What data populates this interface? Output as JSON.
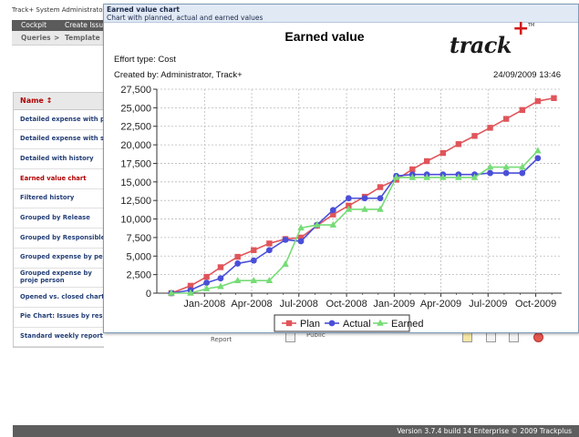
{
  "app": {
    "title": "Track+ System Administrator",
    "nav": {
      "cockpit": "Cockpit",
      "create_issue": "Create Issu"
    },
    "breadcrumb": {
      "queries": "Queries",
      "sep": ">",
      "templates": "Template"
    }
  },
  "report_list": {
    "header": "Name ↕",
    "items": [
      "Detailed expense with per",
      "Detailed expense with sub",
      "Detailed with history",
      "Earned value chart",
      "Filtered history",
      "Grouped by Release",
      "Grouped by Responsible",
      "Grouped expense by perso",
      "Grouped expense by proje person",
      "Opened vs. closed chart",
      "Pie Chart: Issues by respo",
      "Standard weekly report"
    ],
    "active_index": 3
  },
  "report_row": {
    "type_label": "Report",
    "visibility": "Public"
  },
  "footer": {
    "version": "Version 3.7.4 build 14 Enterprise  © 2009 Trackplus"
  },
  "modal": {
    "title": "Earned value chart",
    "subtitle": "Chart with planned, actual and earned values"
  },
  "report": {
    "logo": "track",
    "logo_plus": "+",
    "logo_tm": "TM",
    "effort_type": "Effort type: Cost",
    "created_by": "Created by: Administrator, Track+",
    "created_at": "24/09/2009 13:46"
  },
  "chart_data": {
    "type": "line",
    "title": "Earned value",
    "xlabel": "",
    "ylabel": "",
    "ylim": [
      0,
      27500
    ],
    "y_ticks": [
      0,
      2500,
      5000,
      7500,
      10000,
      12500,
      15000,
      17500,
      20000,
      22500,
      25000,
      27500
    ],
    "y_tick_labels": [
      "0",
      "2,500",
      "5,000",
      "7,500",
      "10,000",
      "12,500",
      "15,000",
      "17,500",
      "20,000",
      "22,500",
      "25,000",
      "27,500"
    ],
    "xlim": [
      "2007-10-01",
      "2009-11-20"
    ],
    "x_ticks": [
      "2008-01-01",
      "2008-04-01",
      "2008-07-01",
      "2008-10-01",
      "2009-01-01",
      "2009-04-01",
      "2009-07-01",
      "2009-10-01"
    ],
    "x_tick_labels": [
      "Jan-2008",
      "Apr-2008",
      "Jul-2008",
      "Oct-2008",
      "Jan-2009",
      "Apr-2009",
      "Jul-2009",
      "Oct-2009"
    ],
    "grid": true,
    "legend_position": "bottom",
    "series": [
      {
        "name": "Plan",
        "color": "#e0555a",
        "marker": "square",
        "points": [
          [
            "2007-10-29",
            0
          ],
          [
            "2007-12-05",
            1000
          ],
          [
            "2008-01-05",
            2200
          ],
          [
            "2008-02-01",
            3500
          ],
          [
            "2008-03-05",
            4900
          ],
          [
            "2008-04-05",
            5800
          ],
          [
            "2008-05-05",
            6700
          ],
          [
            "2008-06-05",
            7300
          ],
          [
            "2008-07-05",
            7500
          ],
          [
            "2008-08-05",
            9100
          ],
          [
            "2008-09-05",
            10600
          ],
          [
            "2008-10-05",
            11800
          ],
          [
            "2008-11-05",
            13000
          ],
          [
            "2008-12-05",
            14300
          ],
          [
            "2009-01-05",
            15300
          ],
          [
            "2009-02-05",
            16700
          ],
          [
            "2009-03-05",
            17800
          ],
          [
            "2009-04-05",
            18900
          ],
          [
            "2009-05-05",
            20100
          ],
          [
            "2009-06-05",
            21200
          ],
          [
            "2009-07-05",
            22300
          ],
          [
            "2009-08-05",
            23500
          ],
          [
            "2009-09-05",
            24700
          ],
          [
            "2009-10-05",
            25900
          ],
          [
            "2009-11-05",
            26300
          ]
        ]
      },
      {
        "name": "Actual",
        "color": "#4a4fd8",
        "marker": "circle",
        "points": [
          [
            "2007-10-29",
            0
          ],
          [
            "2007-12-05",
            400
          ],
          [
            "2008-01-05",
            1400
          ],
          [
            "2008-02-01",
            2000
          ],
          [
            "2008-03-05",
            4000
          ],
          [
            "2008-04-05",
            4400
          ],
          [
            "2008-05-05",
            5800
          ],
          [
            "2008-06-05",
            7200
          ],
          [
            "2008-07-05",
            7000
          ],
          [
            "2008-08-05",
            9200
          ],
          [
            "2008-09-05",
            11200
          ],
          [
            "2008-10-05",
            12800
          ],
          [
            "2008-11-05",
            12800
          ],
          [
            "2008-12-05",
            12800
          ],
          [
            "2009-01-05",
            15800
          ],
          [
            "2009-02-05",
            16000
          ],
          [
            "2009-03-05",
            16000
          ],
          [
            "2009-04-05",
            16000
          ],
          [
            "2009-05-05",
            16000
          ],
          [
            "2009-06-05",
            16000
          ],
          [
            "2009-07-05",
            16200
          ],
          [
            "2009-08-05",
            16200
          ],
          [
            "2009-09-05",
            16200
          ],
          [
            "2009-10-05",
            18200
          ]
        ]
      },
      {
        "name": "Earned",
        "color": "#76dc76",
        "marker": "triangle",
        "points": [
          [
            "2007-10-29",
            0
          ],
          [
            "2007-12-05",
            0
          ],
          [
            "2008-01-05",
            600
          ],
          [
            "2008-02-01",
            900
          ],
          [
            "2008-03-05",
            1700
          ],
          [
            "2008-04-05",
            1700
          ],
          [
            "2008-05-05",
            1700
          ],
          [
            "2008-06-05",
            3900
          ],
          [
            "2008-07-05",
            8800
          ],
          [
            "2008-08-05",
            9200
          ],
          [
            "2008-09-05",
            9200
          ],
          [
            "2008-10-05",
            11300
          ],
          [
            "2008-11-05",
            11300
          ],
          [
            "2008-12-05",
            11300
          ],
          [
            "2009-01-05",
            15600
          ],
          [
            "2009-02-05",
            15600
          ],
          [
            "2009-03-05",
            15600
          ],
          [
            "2009-04-05",
            15600
          ],
          [
            "2009-05-05",
            15600
          ],
          [
            "2009-06-05",
            15600
          ],
          [
            "2009-07-05",
            17000
          ],
          [
            "2009-08-05",
            17000
          ],
          [
            "2009-09-05",
            17000
          ],
          [
            "2009-10-05",
            19200
          ]
        ]
      }
    ]
  }
}
